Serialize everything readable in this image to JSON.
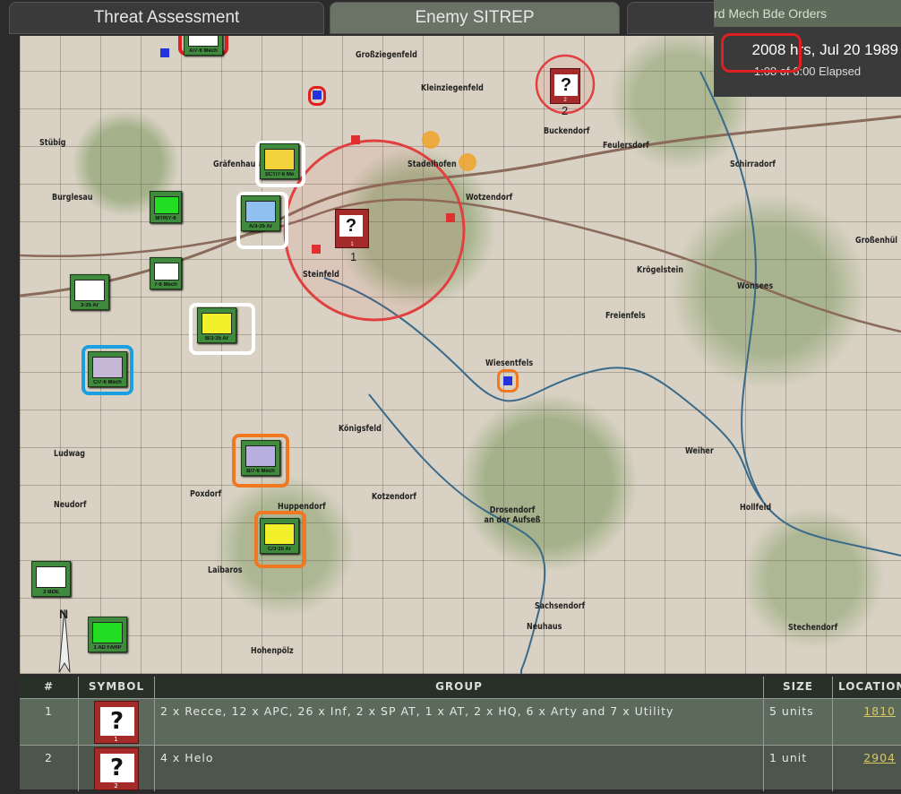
{
  "tabs": [
    {
      "label": "Threat Assessment"
    },
    {
      "label": "Enemy SITREP"
    },
    {
      "label": ""
    }
  ],
  "clock": {
    "header": "rd Mech Bde Orders",
    "time": "2008 hrs, Jul 20 1989",
    "elapsed": "1:08 of 6:00 Elapsed"
  },
  "places": [
    "Großziegenfeld",
    "Kleinziegenfeld",
    "Buckendorf",
    "Feulersdorf",
    "Stübig",
    "Gräfenhaus",
    "Stadelhofen",
    "Wotzendorf",
    "Schirradorf",
    "Burglesau",
    "Steinfeld",
    "Krögelstein",
    "Wonsees",
    "Großenhül",
    "Freienfels",
    "Wiesentfels",
    "Königsfeld",
    "Ludwag",
    "Weiher",
    "Poxdorf",
    "Kotzendorf",
    "Neudorf",
    "Huppendorf",
    "Drosendorf an der Aufseß",
    "Hollfeld",
    "Laibaros",
    "Sachsendorf",
    "Neuhaus",
    "Stechendorf",
    "Hohenpölz"
  ],
  "units": [
    {
      "label": "A/7-6 Mech",
      "fill": "#ffffff"
    },
    {
      "label": "SCT/7-6 Me",
      "fill": "#f2d23a"
    },
    {
      "label": "MTR/7-6",
      "fill": "#22dd22"
    },
    {
      "label": "A/3-35 Ar",
      "fill": "#8fc0f0"
    },
    {
      "label": "7-6 Mech",
      "fill": "#ffffff"
    },
    {
      "label": "3-35 Ar",
      "fill": "#ffffff"
    },
    {
      "label": "B/3-35 Ar",
      "fill": "#f2f02a"
    },
    {
      "label": "C/7-6 Mech",
      "fill": "#c8b8d8"
    },
    {
      "label": "B/7-6 Mech",
      "fill": "#b8b0e0"
    },
    {
      "label": "C/3-35 Ar",
      "fill": "#f2f02a"
    },
    {
      "label": "3 BDE",
      "fill": "#ffffff"
    },
    {
      "label": "1 AD FARP",
      "fill": "#22dd22"
    }
  ],
  "enemies": [
    {
      "id": "1",
      "symbol": "?"
    },
    {
      "id": "2",
      "symbol": "?"
    }
  ],
  "highlight_colors": {
    "red": "#e02020",
    "white": "#ffffff",
    "orange": "#f07820",
    "blue": "#1aa0e0"
  },
  "table": {
    "headers": [
      "#",
      "SYMBOL",
      "GROUP",
      "SIZE",
      "LOCATION"
    ],
    "rows": [
      {
        "num": "1",
        "symbol": "?",
        "sym_num": "1",
        "group": "2 x Recce, 12 x APC, 26 x Inf, 2 x SP AT, 1 x AT, 2 x HQ, 6 x Arty and 7 x Utility",
        "size": "5 units",
        "location": "1810"
      },
      {
        "num": "2",
        "symbol": "?",
        "sym_num": "2",
        "group": "4 x Helo",
        "size": "1 unit",
        "location": "2904"
      }
    ]
  }
}
